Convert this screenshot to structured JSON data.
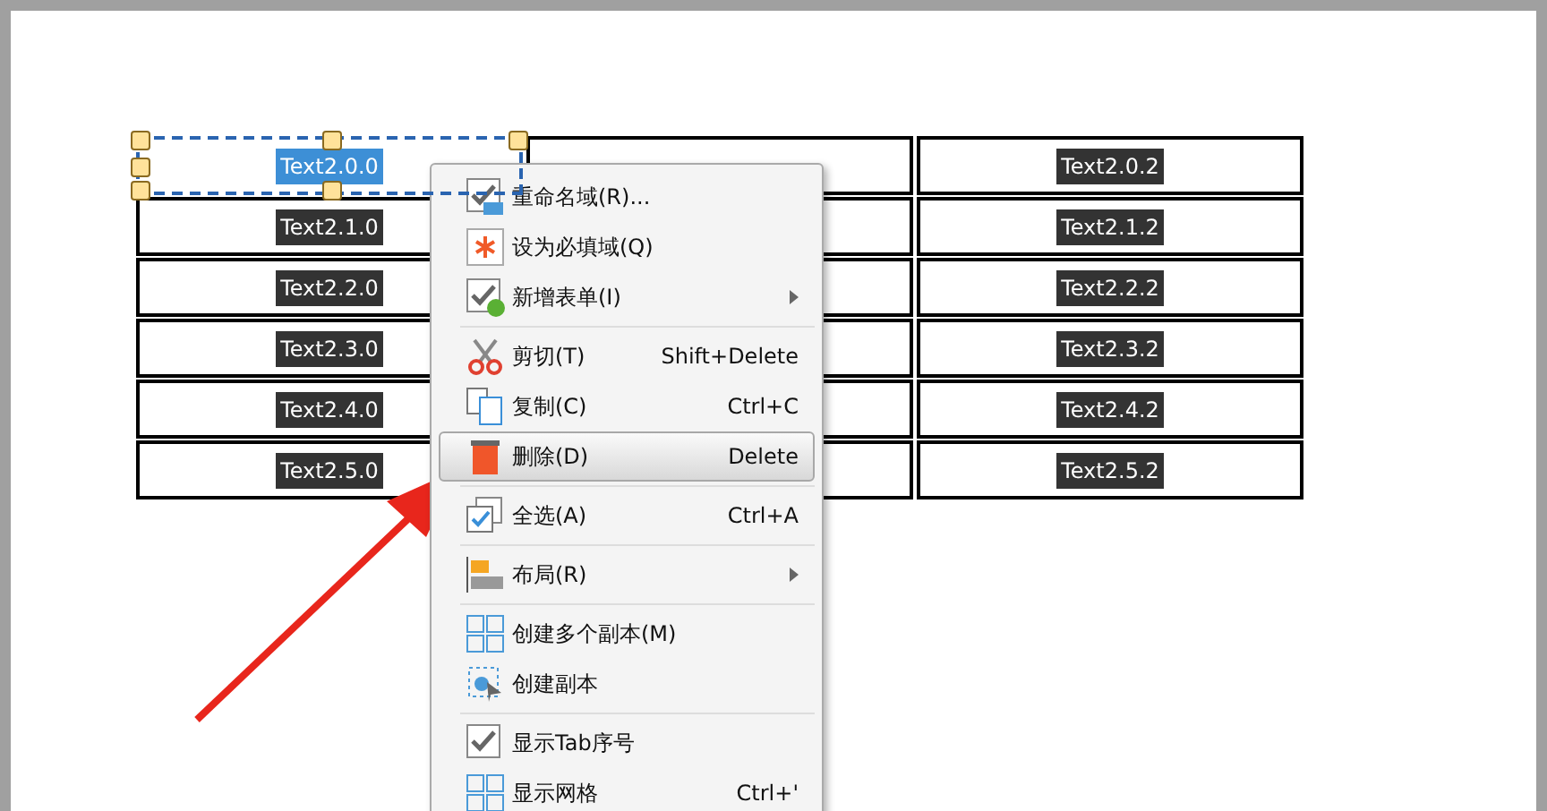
{
  "table": {
    "rows": [
      {
        "cells": [
          {
            "text": "Text2.0.0",
            "selected": true
          },
          {
            "text": "",
            "selected": false
          },
          {
            "text": "Text2.0.2",
            "selected": false
          }
        ]
      },
      {
        "cells": [
          {
            "text": "Text2.1.0",
            "selected": false
          },
          {
            "text": "",
            "selected": false
          },
          {
            "text": "Text2.1.2",
            "selected": false
          }
        ]
      },
      {
        "cells": [
          {
            "text": "Text2.2.0",
            "selected": false
          },
          {
            "text": "",
            "selected": false
          },
          {
            "text": "Text2.2.2",
            "selected": false
          }
        ]
      },
      {
        "cells": [
          {
            "text": "Text2.3.0",
            "selected": false
          },
          {
            "text": "",
            "selected": false
          },
          {
            "text": "Text2.3.2",
            "selected": false
          }
        ]
      },
      {
        "cells": [
          {
            "text": "Text2.4.0",
            "selected": false
          },
          {
            "text": "",
            "selected": false
          },
          {
            "text": "Text2.4.2",
            "selected": false
          }
        ]
      },
      {
        "cells": [
          {
            "text": "Text2.5.0",
            "selected": false
          },
          {
            "text": "",
            "selected": false
          },
          {
            "text": "Text2.5.2",
            "selected": false
          }
        ]
      }
    ]
  },
  "context_menu": {
    "items": [
      {
        "kind": "item",
        "label": "重命名域(R)...",
        "selected": false,
        "submenu": false
      },
      {
        "kind": "item",
        "label": "设为必填域(Q)",
        "selected": false,
        "submenu": false
      },
      {
        "kind": "item",
        "label": "新增表单(I)",
        "selected": false,
        "submenu": true
      },
      {
        "kind": "separator"
      },
      {
        "kind": "item",
        "label": "剪切(T)",
        "shortcut": "Shift+Delete",
        "selected": false,
        "submenu": false
      },
      {
        "kind": "item",
        "label": "复制(C)",
        "shortcut": "Ctrl+C",
        "selected": false,
        "submenu": false
      },
      {
        "kind": "item",
        "label": "删除(D)",
        "shortcut": "Delete",
        "selected": true,
        "submenu": false
      },
      {
        "kind": "separator"
      },
      {
        "kind": "item",
        "label": "全选(A)",
        "shortcut": "Ctrl+A",
        "selected": false,
        "submenu": false
      },
      {
        "kind": "separator"
      },
      {
        "kind": "item",
        "label": "布局(R)",
        "selected": false,
        "submenu": true
      },
      {
        "kind": "separator"
      },
      {
        "kind": "item",
        "label": "创建多个副本(M)",
        "selected": false,
        "submenu": false
      },
      {
        "kind": "item",
        "label": "创建副本",
        "selected": false,
        "submenu": false
      },
      {
        "kind": "separator"
      },
      {
        "kind": "item",
        "label": "显示Tab序号",
        "selected": false,
        "submenu": false
      },
      {
        "kind": "item",
        "label": "显示网格",
        "shortcut": "Ctrl+'",
        "selected": false,
        "submenu": false
      }
    ]
  }
}
